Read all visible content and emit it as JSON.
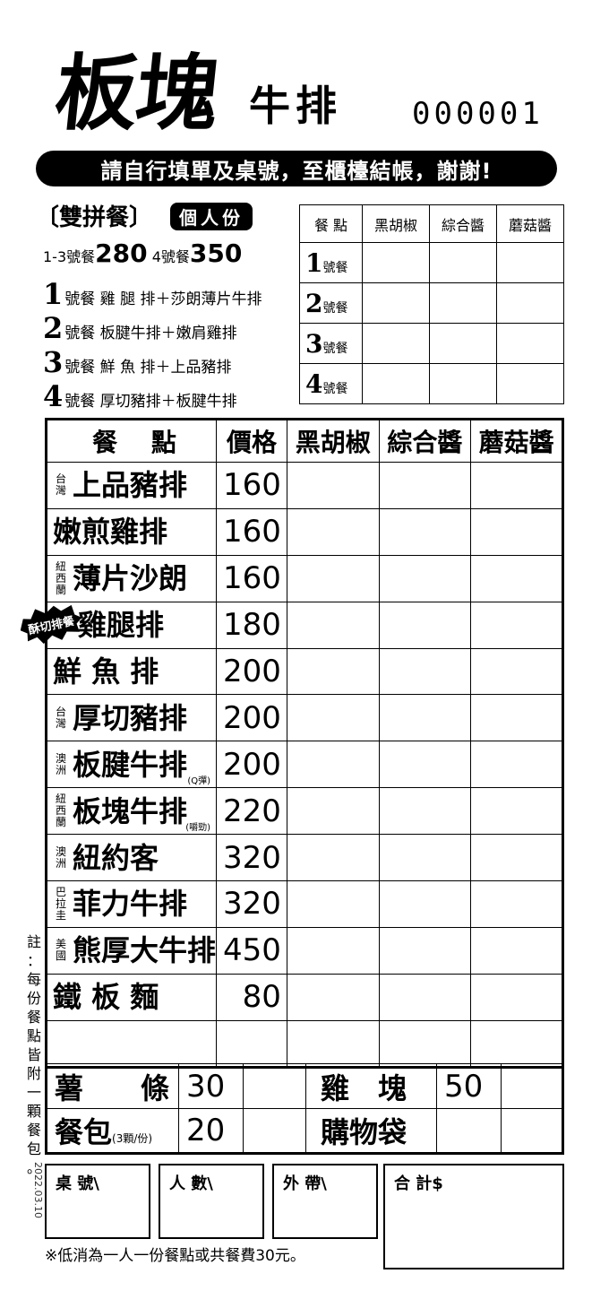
{
  "header": {
    "logo": "板塊",
    "logo_sub": "牛排",
    "serial": "000001",
    "banner": "請自行填單及桌號，至櫃檯結帳，謝謝!"
  },
  "combo": {
    "title": "〔雙拼餐〕",
    "badge": "個人份",
    "price_label_a": "1-3號餐",
    "price_a": "280",
    "price_label_b": "4號餐",
    "price_b": "350",
    "items": [
      {
        "num": "1",
        "text": "號餐 雞 腿 排＋莎朗薄片牛排"
      },
      {
        "num": "2",
        "text": "號餐 板腱牛排＋嫩肩雞排"
      },
      {
        "num": "3",
        "text": "號餐 鮮 魚 排＋上品豬排"
      },
      {
        "num": "4",
        "text": "號餐 厚切豬排＋板腱牛排"
      }
    ],
    "grid_header": [
      "餐 點",
      "黑胡椒",
      "綜合醬",
      "蘑菇醬"
    ],
    "grid_rows": [
      {
        "num": "1",
        "label": "號餐"
      },
      {
        "num": "2",
        "label": "號餐"
      },
      {
        "num": "3",
        "label": "號餐"
      },
      {
        "num": "4",
        "label": "號餐"
      }
    ]
  },
  "menu": {
    "header": [
      "餐　 點",
      "價格",
      "黑胡椒",
      "綜合醬",
      "蘑菇醬"
    ],
    "items": [
      {
        "origin": [
          "台",
          "灣"
        ],
        "name": "上品豬排",
        "price": "160"
      },
      {
        "origin": [],
        "name": "嫩煎雞排",
        "price": "160"
      },
      {
        "origin": [
          "紐",
          "西",
          "蘭"
        ],
        "name": "薄片沙朗",
        "price": "160"
      },
      {
        "origin": [],
        "name": "雞腿排",
        "price": "180"
      },
      {
        "origin": [],
        "name": "鮮 魚 排",
        "price": "200"
      },
      {
        "origin": [
          "台",
          "灣"
        ],
        "name": "厚切豬排",
        "price": "200"
      },
      {
        "origin": [
          "澳",
          "洲"
        ],
        "name": "板腱牛排",
        "price": "200",
        "note": "(Q彈)"
      },
      {
        "origin": [
          "紐",
          "西",
          "蘭"
        ],
        "name": "板塊牛排",
        "price": "220",
        "note": "(嚼勁)"
      },
      {
        "origin": [
          "澳",
          "洲"
        ],
        "name": "紐約客",
        "price": "320"
      },
      {
        "origin": [
          "巴",
          "拉",
          "圭"
        ],
        "name": "菲力牛排",
        "price": "320"
      },
      {
        "origin": [
          "美",
          "國"
        ],
        "name": "熊厚大牛排",
        "price": "450"
      },
      {
        "origin": [],
        "name": "鐵 板 麵",
        "price": "80"
      },
      {
        "origin": [],
        "name": "",
        "price": ""
      }
    ],
    "star_badge": "酥切排餐"
  },
  "sides": {
    "fries_label": "薯　　條",
    "fries_price": "30",
    "nugget_label": "雞　塊",
    "nugget_price": "50",
    "bread_label": "餐包",
    "bread_note": "(3顆/份)",
    "bread_price": "20",
    "bag_label": "購物袋"
  },
  "side_note": [
    "註",
    "：",
    "每",
    "份",
    "餐",
    "點",
    "皆",
    "附",
    "一",
    "顆",
    "餐",
    "包",
    "。"
  ],
  "side_code": "2022.03.10",
  "boxes": {
    "table": "桌 號\\",
    "people": "人 數\\",
    "takeout": "外 帶\\",
    "total": "合 計$"
  },
  "footer": "※低消為一人一份餐點或共餐費30元。"
}
